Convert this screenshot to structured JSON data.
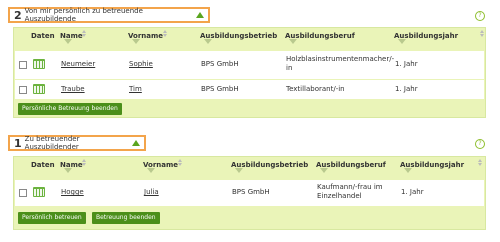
{
  "section1": {
    "count": "2",
    "title": "Von mir persönlich zu betreuende Auszubildende",
    "columns": [
      "Daten",
      "Name",
      "Vorname",
      "Ausbildungsbetrieb",
      "Ausbildungsberuf",
      "Ausbildungsjahr"
    ],
    "rows": [
      {
        "name": "Neumeier",
        "vorname": "Sophie",
        "betrieb": "BPS GmbH",
        "beruf": "Holzblasinstrumentenmacher/-in",
        "jahr": "1. Jahr"
      },
      {
        "name": "Traube",
        "vorname": "Tim",
        "betrieb": "BPS GmbH",
        "beruf": "Textillaborant/-in",
        "jahr": "1. Jahr"
      }
    ],
    "buttons": [
      "Persönliche Betreuung beenden"
    ]
  },
  "section2": {
    "count": "1",
    "title": "Zu betreuender Auszubildender",
    "columns": [
      "Daten",
      "Name",
      "Vorname",
      "Ausbildungsbetrieb",
      "Ausbildungsberuf",
      "Ausbildungsjahr"
    ],
    "rows": [
      {
        "name": "Hogge",
        "vorname": "Julia",
        "betrieb": "BPS GmbH",
        "beruf": "Kaufmann/-frau im Einzelhandel",
        "jahr": "1. Jahr"
      }
    ],
    "buttons": [
      "Persönlich betreuen",
      "Betreuung beenden"
    ]
  },
  "help_glyph": "?",
  "colors": {
    "accent_orange": "#f3a44b",
    "panel_green": "#eaf4b8",
    "button_green": "#4b8f1a"
  }
}
